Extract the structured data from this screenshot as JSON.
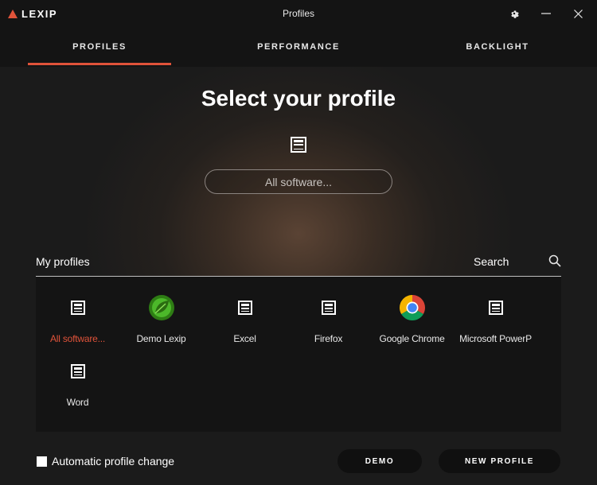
{
  "app": {
    "logo_text": "LEXIP",
    "window_title": "Profiles",
    "accent": "#e0533a"
  },
  "window_controls": {
    "settings_icon": "gear-icon",
    "minimize_icon": "minimize-icon",
    "close_icon": "close-icon"
  },
  "tabs": [
    {
      "label": "PROFILES",
      "active": true
    },
    {
      "label": "PERFORMANCE",
      "active": false
    },
    {
      "label": "BACKLIGHT",
      "active": false
    }
  ],
  "hero": {
    "heading": "Select your profile",
    "selected_value": "All software..."
  },
  "profiles_section": {
    "title": "My profiles",
    "search_label": "Search"
  },
  "profiles": [
    {
      "label": "All software...",
      "icon": "document-icon",
      "selected": true
    },
    {
      "label": "Demo Lexip",
      "icon": "leaf-icon",
      "selected": false
    },
    {
      "label": "Excel",
      "icon": "document-icon",
      "selected": false
    },
    {
      "label": "Firefox",
      "icon": "document-icon",
      "selected": false
    },
    {
      "label": "Google Chrome",
      "icon": "chrome-icon",
      "selected": false
    },
    {
      "label": "Microsoft PowerP",
      "icon": "document-icon",
      "selected": false
    },
    {
      "label": "Word",
      "icon": "document-icon",
      "selected": false
    }
  ],
  "footer": {
    "auto_change_label": "Automatic profile change",
    "auto_change_checked": false,
    "demo_button": "DEMO",
    "new_profile_button": "NEW PROFILE"
  }
}
